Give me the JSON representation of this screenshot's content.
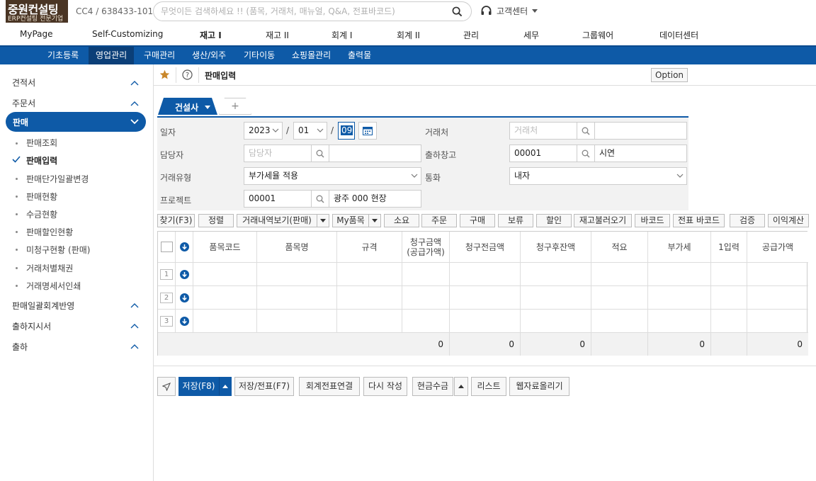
{
  "header": {
    "logo_title": "중원컨설팅",
    "logo_subtitle": "ERP컨설팅 전문기업",
    "company_code": "CC4 / 638433-101",
    "search_placeholder": "무엇이든 검색하세요 !! (품목, 거래처, 매뉴얼, Q&A, 전표바코드)",
    "help_center": "고객센터"
  },
  "main_menu": [
    "MyPage",
    "Self-Customizing",
    "재고 I",
    "재고 II",
    "회계 I",
    "회계 II",
    "관리",
    "세무",
    "그룹웨어",
    "데이터센터"
  ],
  "main_menu_active": "재고 I",
  "sub_menu": [
    "기초등록",
    "영업관리",
    "구매관리",
    "생산/외주",
    "기타이동",
    "쇼핑몰관리",
    "출력물"
  ],
  "sub_menu_active": "영업관리",
  "sidebar": {
    "groups_top": [
      "견적서",
      "주문서"
    ],
    "active_group": "판매",
    "items": [
      "판매조회",
      "판매입력",
      "판매단가일괄변경",
      "판매현황",
      "수금현황",
      "판매할인현황",
      "미청구현황 (판매)",
      "거래처별채권",
      "거래명세서인쇄"
    ],
    "current_item": "판매입력",
    "groups_bottom": [
      "판매일괄회계반영",
      "출하지시서",
      "출하"
    ]
  },
  "page": {
    "title": "판매입력",
    "option_label": "Option",
    "tab_label": "건설사",
    "tab_add": "+"
  },
  "form": {
    "date_label": "일자",
    "year": "2023",
    "month": "01",
    "day": "09",
    "customer_label": "거래처",
    "customer_placeholder": "거래처",
    "manager_label": "담당자",
    "manager_placeholder": "담당자",
    "warehouse_label": "출하창고",
    "warehouse_code": "00001",
    "warehouse_name": "시연",
    "trade_type_label": "거래유형",
    "trade_type_value": "부가세율 적용",
    "currency_label": "통화",
    "currency_value": "내자",
    "project_label": "프로젝트",
    "project_code": "00001",
    "project_name": "광주 000 현장"
  },
  "toolbar": [
    "찾기(F3)",
    "정렬",
    "거래내역보기(판매)",
    "My품목",
    "소요",
    "주문",
    "구매",
    "보류",
    "할인",
    "재고불러오기",
    "바코드",
    "전표 바코드",
    "검증",
    "이익계산"
  ],
  "grid": {
    "headers": [
      "품목코드",
      "품목명",
      "규격",
      "청구금액\n(공급가액)",
      "청구전금액",
      "청구후잔액",
      "적요",
      "부가세",
      "1입력",
      "공급가액"
    ],
    "row_numbers": [
      "1",
      "2",
      "3"
    ],
    "totals": [
      "0",
      "0",
      "0",
      "0",
      "0"
    ]
  },
  "bottom_buttons": [
    "저장(F8)",
    "저장/전표(F7)",
    "회계전표연결",
    "다시 작성",
    "현금수금",
    "리스트",
    "웹자료올리기"
  ],
  "colors": {
    "primary": "#0e5aa7",
    "logo_bg": "#4a3524"
  }
}
